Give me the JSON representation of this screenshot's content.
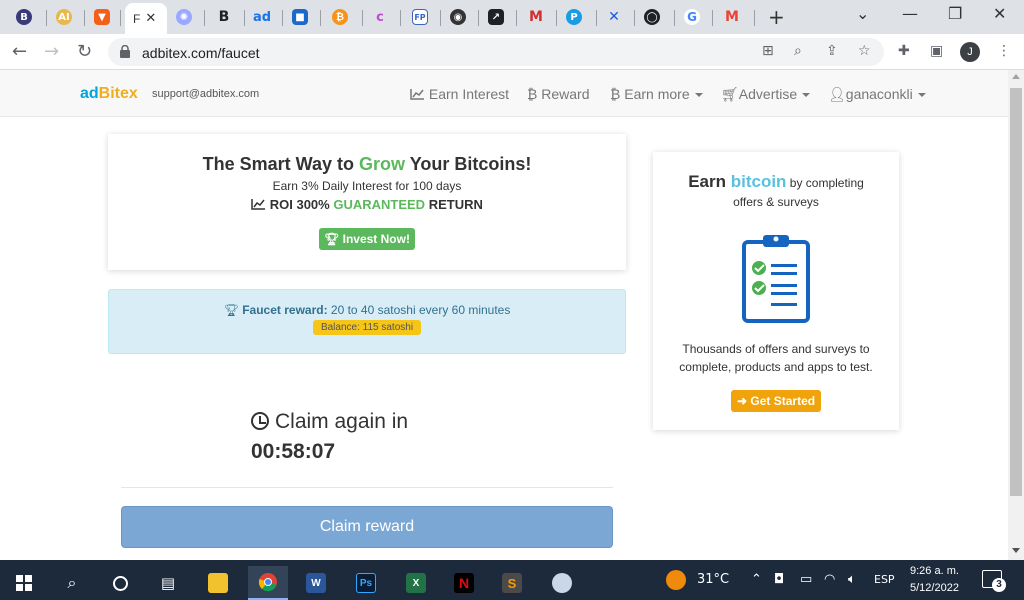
{
  "browser": {
    "active_tab_label": "F",
    "close_glyph": "✕",
    "new_tab_glyph": "+",
    "window_controls": [
      "⌄",
      "—",
      "❐",
      "✕"
    ],
    "url": "adbitex.com/faucet",
    "profile_initial": "J",
    "tabs": [
      {
        "icon": "circle-coin-icon",
        "color": "#3a3a7a",
        "glyph": "B"
      },
      {
        "icon": "ai-icon",
        "color": "#e8b84a",
        "glyph": "AI"
      },
      {
        "icon": "brave-icon",
        "color": "#f4601a",
        "glyph": "▼"
      },
      {
        "icon": "globe-icon",
        "color": "#9aa8ff",
        "glyph": "✺"
      },
      {
        "icon": "bold-b-icon",
        "color": "#202124",
        "glyph": "B"
      },
      {
        "icon": "adbitex-icon",
        "color": "#1a73e8",
        "glyph": "ad"
      },
      {
        "icon": "shield-icon",
        "color": "#1b6ac9",
        "glyph": "■"
      },
      {
        "icon": "bitcoin-icon",
        "color": "#f7931a",
        "glyph": "₿"
      },
      {
        "icon": "c-icon",
        "color": "#c04bd4",
        "glyph": "c"
      },
      {
        "icon": "fp-icon",
        "color": "#3b66c4",
        "glyph": "FP"
      },
      {
        "icon": "penguin-icon",
        "color": "#333333",
        "glyph": "◉"
      },
      {
        "icon": "arrow-icon",
        "color": "#202124",
        "glyph": "↗"
      },
      {
        "icon": "m-icon",
        "color": "#d32f2f",
        "glyph": "M"
      },
      {
        "icon": "search-p-icon",
        "color": "#1a9be6",
        "glyph": "P"
      },
      {
        "icon": "cross-icon",
        "color": "#1a5ae6",
        "glyph": "✕"
      },
      {
        "icon": "github-icon",
        "color": "#202124",
        "glyph": "◯"
      },
      {
        "icon": "google-icon",
        "color": "#4285f4",
        "glyph": "G"
      },
      {
        "icon": "gmail-icon",
        "color": "#ea4335",
        "glyph": "M"
      }
    ]
  },
  "site": {
    "brand_ad": "ad",
    "brand_bitex": "Bitex",
    "support_email": "support@adbitex.com",
    "nav": {
      "earn_interest": "Earn Interest",
      "reward": "Reward",
      "earn_more": "Earn more",
      "advertise": "Advertise",
      "user": "ganaconkli"
    }
  },
  "invest": {
    "title_pre": "The Smart Way to ",
    "title_grow": "Grow",
    "title_post": " Your Bitcoins!",
    "subtitle": "Earn 3% Daily Interest for 100 days",
    "roi_pre": "ROI 300% ",
    "roi_guaranteed": "GUARANTEED",
    "roi_post": " RETURN",
    "button": "Invest Now!"
  },
  "faucet": {
    "reward_label": "Faucet reward:",
    "reward_text": " 20 to 40 satoshi every 60 minutes",
    "balance": "Balance: 115 satoshi"
  },
  "claim": {
    "again_label": "Claim again in",
    "countdown": "00:58:07",
    "button": "Claim reward"
  },
  "survey": {
    "title_earn": "Earn ",
    "title_bitcoin": "bitcoin",
    "title_rest": " by completing",
    "subtitle": "offers & surveys",
    "desc_line1": "Thousands of offers and surveys to",
    "desc_line2": "complete, products and apps to test.",
    "button": "Get Started"
  },
  "taskbar": {
    "temperature": "31°C",
    "language": "ESP",
    "time": "9:26 a. m.",
    "date": "5/12/2022",
    "notifications": "3"
  },
  "colors": {
    "accent_green": "#5cb85c",
    "info_blue": "#d9edf7",
    "claim_button": "#7ba7d4",
    "started_button": "#f0a30a"
  }
}
